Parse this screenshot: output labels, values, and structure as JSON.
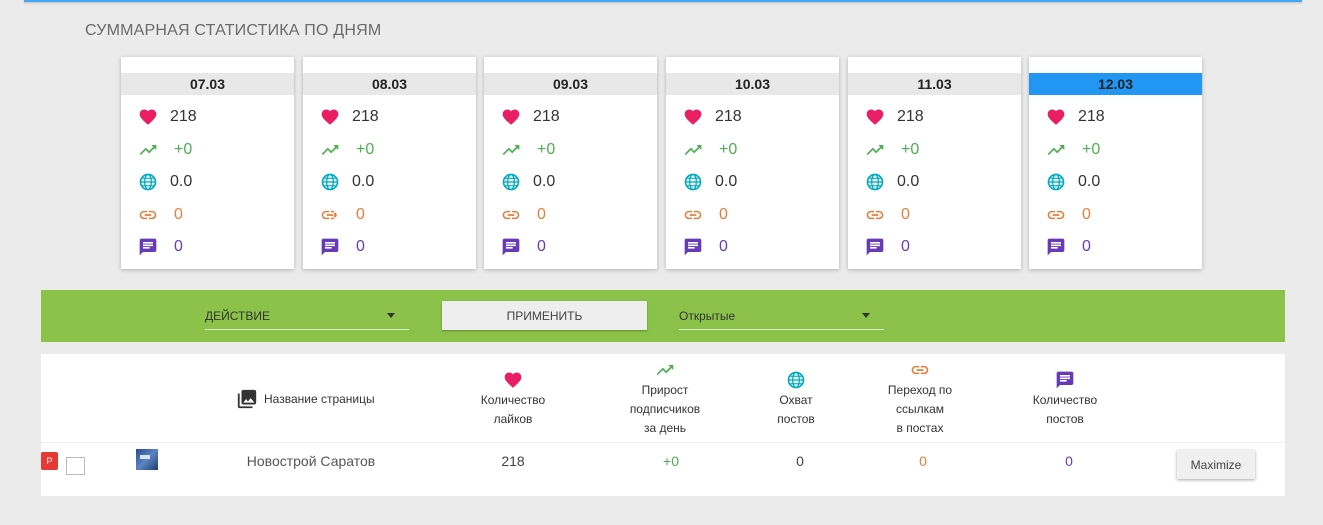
{
  "section_title": "СУММАРНАЯ СТАТИСТИКА ПО ДНЯМ",
  "colors": {
    "likes": "#e91e63",
    "growth": "#4caf50",
    "reach": "#00acc1",
    "links": "#e67e3b",
    "posts": "#673ab7",
    "action_bar": "#8bc34a",
    "active_date": "#2196f3"
  },
  "cards": [
    {
      "date": "07.03",
      "likes": "218",
      "growth": "+0",
      "reach": "0.0",
      "links": "0",
      "posts": "0",
      "active": false
    },
    {
      "date": "08.03",
      "likes": "218",
      "growth": "+0",
      "reach": "0.0",
      "links": "0",
      "posts": "0",
      "active": false
    },
    {
      "date": "09.03",
      "likes": "218",
      "growth": "+0",
      "reach": "0.0",
      "links": "0",
      "posts": "0",
      "active": false
    },
    {
      "date": "10.03",
      "likes": "218",
      "growth": "+0",
      "reach": "0.0",
      "links": "0",
      "posts": "0",
      "active": false
    },
    {
      "date": "11.03",
      "likes": "218",
      "growth": "+0",
      "reach": "0.0",
      "links": "0",
      "posts": "0",
      "active": false
    },
    {
      "date": "12.03",
      "likes": "218",
      "growth": "+0",
      "reach": "0.0",
      "links": "0",
      "posts": "0",
      "active": true
    }
  ],
  "action_bar": {
    "action_select": "ДЕЙСТВИЕ",
    "apply_label": "ПРИМЕНИТЬ",
    "filter_select": "Открытые"
  },
  "table": {
    "headers": {
      "page_name": "Название страницы",
      "likes": [
        "Количество",
        "лайков"
      ],
      "growth": [
        "Прирост",
        "подписчиков",
        "за день"
      ],
      "reach": [
        "Охват",
        "постов"
      ],
      "links": [
        "Переход по",
        "ссылкам",
        "в постах"
      ],
      "posts": [
        "Количество",
        "постов"
      ]
    },
    "rows": [
      {
        "badge": "P",
        "name": "Новострой Саратов",
        "likes": "218",
        "growth": "+0",
        "reach": "0",
        "links": "0",
        "posts": "0"
      }
    ]
  },
  "maximize_label": "Maximize"
}
